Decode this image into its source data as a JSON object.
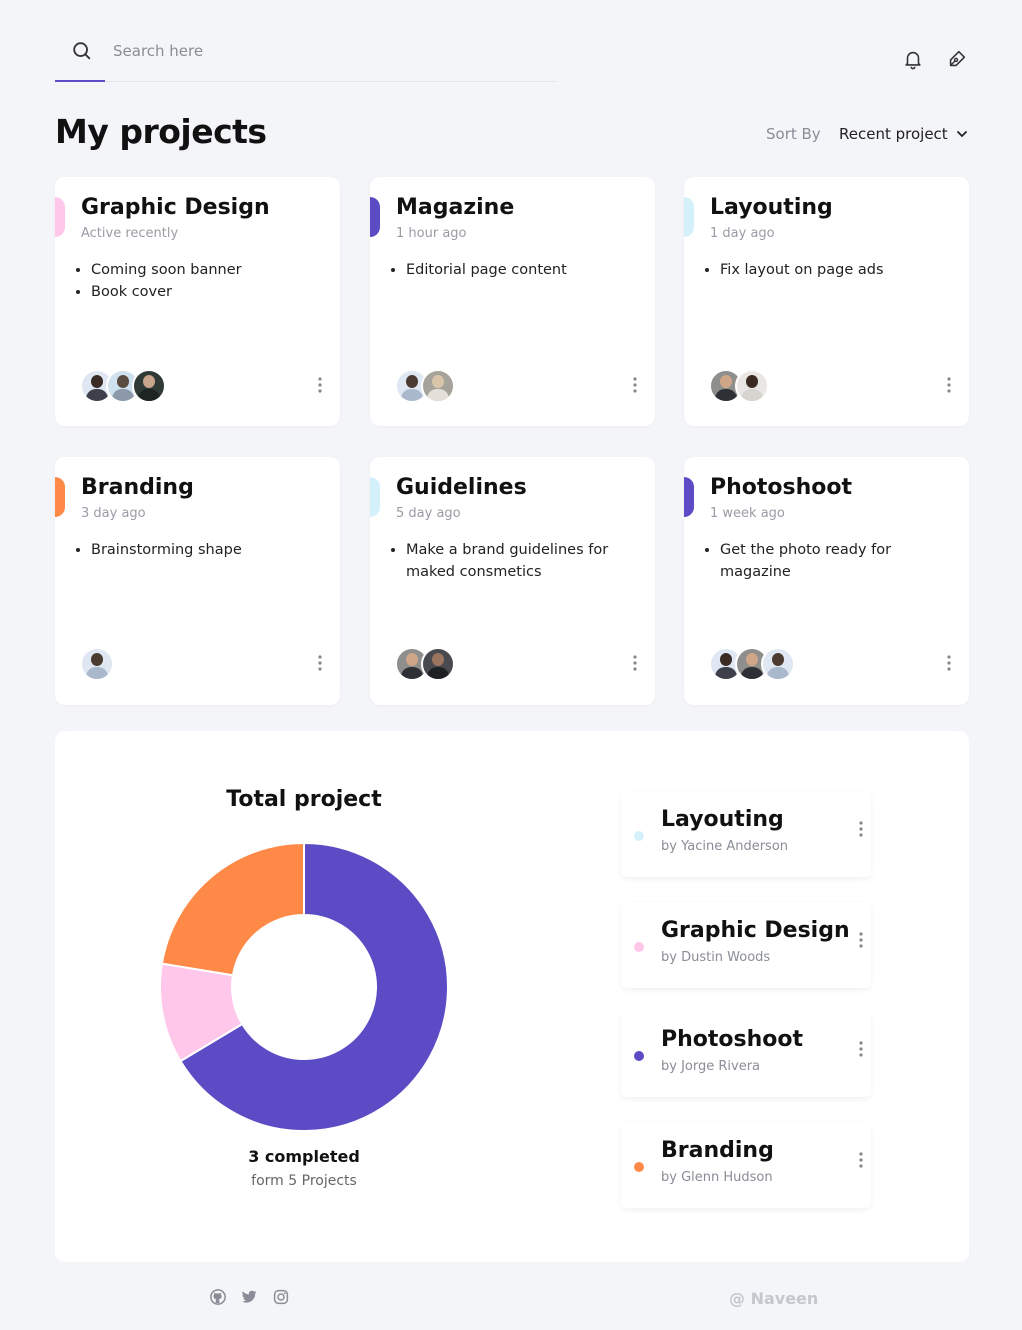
{
  "search": {
    "placeholder": "Search here",
    "icon": "search-icon",
    "accent_color": "#5b4bc4"
  },
  "header": {
    "icons": [
      "bell-icon",
      "pen-icon"
    ]
  },
  "page": {
    "title": "My projects"
  },
  "sort": {
    "label": "Sort By",
    "value": "Recent project"
  },
  "projects": [
    {
      "title": "Graphic Design",
      "time": "Active recently",
      "color": "#ffc7ea",
      "tasks": [
        "Coming soon banner",
        "Book cover"
      ],
      "avatars": 3
    },
    {
      "title": "Magazine",
      "time": "1 hour ago",
      "color": "#5b4bc4",
      "tasks": [
        "Editorial page content"
      ],
      "avatars": 2
    },
    {
      "title": "Layouting",
      "time": "1 day ago",
      "color": "#d4f1fb",
      "tasks": [
        "Fix layout on page ads"
      ],
      "avatars": 2
    },
    {
      "title": "Branding",
      "time": "3 day ago",
      "color": "#ff8a48",
      "tasks": [
        "Brainstorming shape"
      ],
      "avatars": 1
    },
    {
      "title": "Guidelines",
      "time": "5 day ago",
      "color": "#d4f1fb",
      "tasks": [
        "Make a brand guidelines for maked consmetics"
      ],
      "avatars": 2
    },
    {
      "title": "Photoshoot",
      "time": "1 week ago",
      "color": "#5b4bc4",
      "tasks": [
        "Get the photo ready for magazine"
      ],
      "avatars": 3
    }
  ],
  "total": {
    "title": "Total project",
    "completed": "3 completed",
    "subtitle": "form 5 Projects"
  },
  "chart_data": {
    "type": "pie",
    "title": "Total project",
    "slices": [
      {
        "label": "Photoshoot",
        "value": 66.4,
        "color": "#5b4bc4"
      },
      {
        "label": "Graphic Design",
        "value": 11.2,
        "color": "#ffc7ea"
      },
      {
        "label": "Branding",
        "value": 22.4,
        "color": "#ff8a48"
      }
    ]
  },
  "legend": [
    {
      "title": "Layouting",
      "by": "by Yacine Anderson",
      "color": "#d4f1fb"
    },
    {
      "title": "Graphic Design",
      "by": "by Dustin Woods",
      "color": "#ffc7ea"
    },
    {
      "title": "Photoshoot",
      "by": "by Jorge Rivera",
      "color": "#5b4bc4"
    },
    {
      "title": "Branding",
      "by": "by Glenn Hudson",
      "color": "#ff8a48"
    }
  ],
  "footer": {
    "icons": [
      "github-icon",
      "twitter-icon",
      "instagram-icon"
    ],
    "credit": "@ Naveen"
  }
}
